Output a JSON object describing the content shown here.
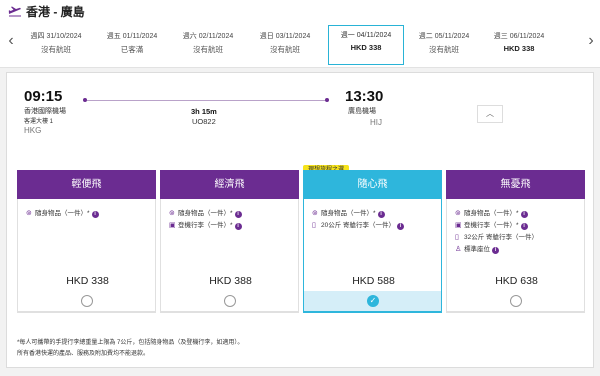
{
  "header": {
    "title": "香港 - 廣島",
    "icon": "plane-depart-icon"
  },
  "date_strip": {
    "prev_icon": "chevron-left-icon",
    "next_icon": "chevron-right-icon",
    "dates": [
      {
        "date": "週四 31/10/2024",
        "status": "沒有航班",
        "selected": false
      },
      {
        "date": "週五 01/11/2024",
        "status": "已客滿",
        "selected": false
      },
      {
        "date": "週六 02/11/2024",
        "status": "沒有航班",
        "selected": false
      },
      {
        "date": "週日 03/11/2024",
        "status": "沒有航班",
        "selected": false
      },
      {
        "date": "週一 04/11/2024",
        "status": "HKD  338",
        "selected": true
      },
      {
        "date": "週二 05/11/2024",
        "status": "沒有航班",
        "selected": false
      },
      {
        "date": "週三 06/11/2024",
        "status": "HKD  338",
        "selected": false
      }
    ]
  },
  "flight": {
    "depart_time": "09:15",
    "depart_airport": "香港國際機場",
    "depart_terminal": "客運大樓 1",
    "depart_code": "HKG",
    "duration": "3h 15m",
    "flight_number": "UO822",
    "arrive_time": "13:30",
    "arrive_airport": "廣島機場",
    "arrive_code": "HIJ",
    "collapse_icon": "chevron-up-icon"
  },
  "recommended_badge": "理想旅程之選",
  "fares": [
    {
      "name": "輕便飛",
      "features": [
        {
          "icon": "carry-on-bag-icon",
          "text": "隨身物品（一件）*"
        }
      ],
      "price": "HKD 338",
      "selected": false
    },
    {
      "name": "經濟飛",
      "features": [
        {
          "icon": "carry-on-bag-icon",
          "text": "隨身物品（一件）*"
        },
        {
          "icon": "cabin-luggage-icon",
          "text": "登機行李（一件）*"
        }
      ],
      "price": "HKD 388",
      "selected": false
    },
    {
      "name": "隨心飛",
      "features": [
        {
          "icon": "carry-on-bag-icon",
          "text": "隨身物品（一件）*"
        },
        {
          "icon": "checked-luggage-icon",
          "text": "20公斤 寄艙行李（一件）"
        }
      ],
      "price": "HKD 588",
      "selected": true
    },
    {
      "name": "無憂飛",
      "features": [
        {
          "icon": "carry-on-bag-icon",
          "text": "隨身物品（一件）*"
        },
        {
          "icon": "cabin-luggage-icon",
          "text": "登機行李（一件）*"
        },
        {
          "icon": "checked-luggage-icon",
          "text": "32公斤 寄艙行李（一件）"
        },
        {
          "icon": "seat-icon",
          "text": "標準座位"
        }
      ],
      "price": "HKD 638",
      "selected": false
    }
  ],
  "colors": {
    "purple": "#6b2c91",
    "cyan": "#2eb6dc",
    "yellow": "#f6e31b"
  },
  "notes": [
    "*每人可攜帶的手提行李總重量上限為 7公斤，包括隨身物品（及登機行李，如適用）。",
    "所有香港快運的產品、服務及附加費均不能退款。"
  ]
}
